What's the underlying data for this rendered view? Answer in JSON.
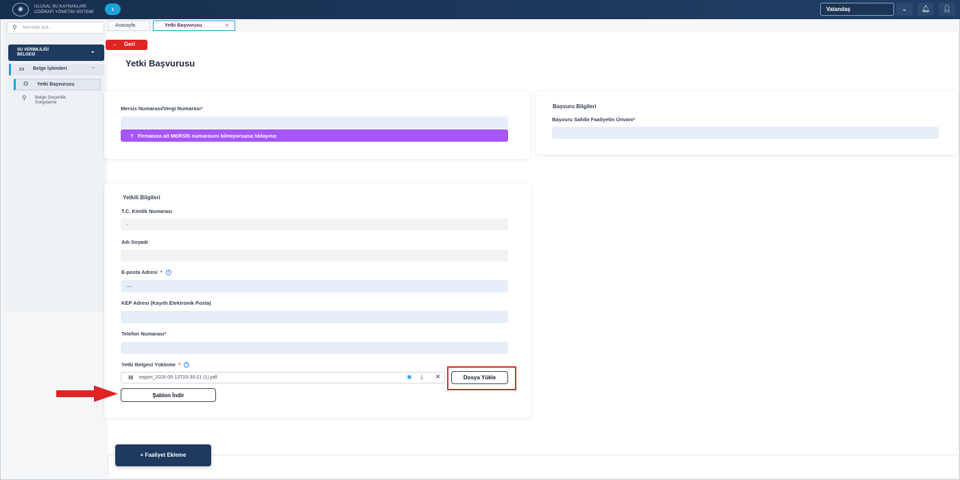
{
  "header": {
    "logo_line1": "ULUSAL SU KAYNAKLARI",
    "logo_line2": "COĞRAFİ YÖNETİM SİSTEMİ",
    "role_select_value": "Vatandaş"
  },
  "sidebar": {
    "search_placeholder": "Menüde ara...",
    "module_line1": "SU VERİMLİLİĞİ",
    "module_line2": "BELGESİ",
    "group_label": "Belge İşlemleri",
    "items": [
      {
        "label": "Yetki Başvurusu"
      },
      {
        "label_line1": "Belge Geçerlilik",
        "label_line2": "Sorgulama"
      }
    ]
  },
  "tabs": [
    {
      "label": "Anasayfa"
    },
    {
      "label": "Yetki Başvurusu"
    }
  ],
  "main": {
    "back_label": "Geri",
    "page_title": "Yetki Başvurusu",
    "mersis": {
      "label": "Mersis Numarası/Vergi Numarası",
      "required": "*",
      "help_text": "Firmanıza ait MERSİS numarasını bilmiyorsanız tıklayınız",
      "help_icon": "?"
    },
    "application": {
      "title": "Başvuru Bilgileri",
      "owner_label": "Başvuru Sahibi Faaliyetin Ünvanı",
      "required": "*"
    },
    "authorized": {
      "title": "Yetkili Bilgileri",
      "tc_label": "T.C. Kimlik Numarası",
      "tc_value": "-",
      "name_label": "Adı Soyadı",
      "email_label": "E-posta Adresi",
      "email_value": "—",
      "kep_label": "KEP Adresi (Kayıtlı Elektronik Posta)",
      "phone_label": "Telefon Numarası",
      "upload_label": "Yetki Belgesi Yükleme",
      "required": "*",
      "file_name": "export_2026-05-13T03-30-21 (1).pdf",
      "upload_button": "Dosya Yükle",
      "template_button": "Şablon İndir"
    },
    "add_activity_button": "+ Faaliyet Ekleme"
  },
  "colors": {
    "header_bg": "#1e3a5f",
    "accent": "#1aa3d9",
    "danger": "#e02424",
    "purple": "#a855f7"
  }
}
